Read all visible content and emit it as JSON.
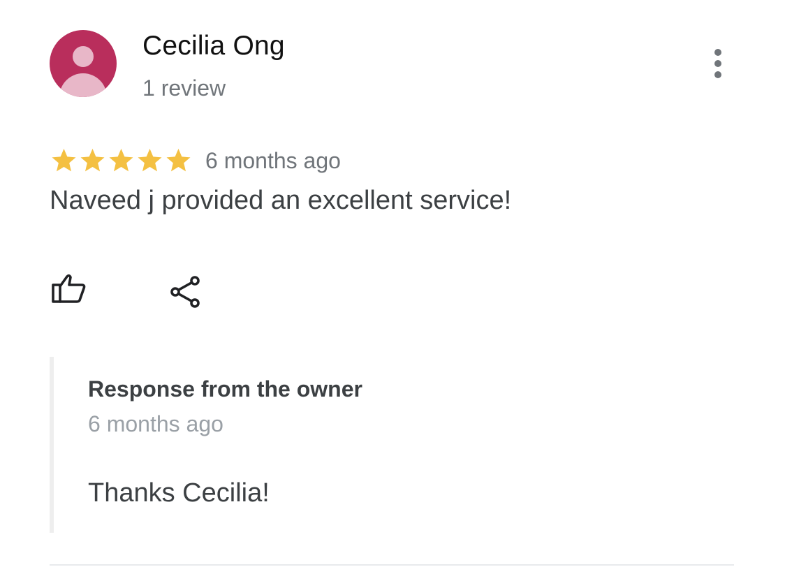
{
  "review": {
    "author": {
      "name": "Cecilia Ong",
      "review_count": "1 review",
      "avatar_color": "#b92e5c"
    },
    "menu_icon": "more-vert-icon",
    "rating": {
      "stars": 5,
      "max_stars": 5,
      "star_color": "#f4c042"
    },
    "date": "6 months ago",
    "text": "Naveed j provided an excellent service!",
    "actions": {
      "like_icon": "thumbs-up-icon",
      "share_icon": "share-icon"
    }
  },
  "owner_response": {
    "title": "Response from the owner",
    "date": "6 months ago",
    "text": "Thanks Cecilia!"
  }
}
